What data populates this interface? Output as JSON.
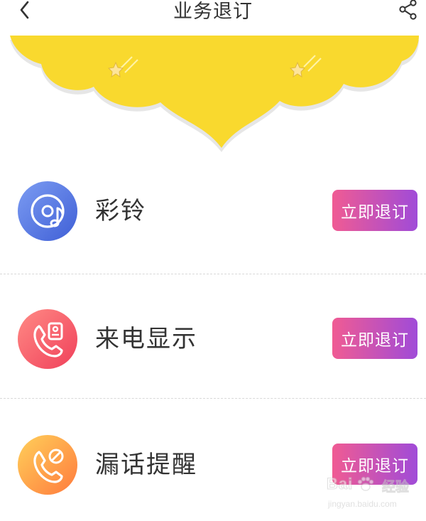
{
  "header": {
    "title": "业务退订",
    "back_icon": "chevron-left-icon",
    "share_icon": "share-icon"
  },
  "banner": {
    "color": "#f9d92e",
    "decorations": [
      "star-icon",
      "star-icon"
    ]
  },
  "services": [
    {
      "name": "彩铃",
      "icon": "music-disc-icon",
      "icon_color": "#4f6fe0",
      "button_label": "立即退订"
    },
    {
      "name": "来电显示",
      "icon": "phone-incoming-icon",
      "icon_color": "#f2526a",
      "button_label": "立即退订"
    },
    {
      "name": "漏话提醒",
      "icon": "phone-missed-icon",
      "icon_color": "#ff9a42",
      "button_label": "立即退订"
    }
  ],
  "button_gradient": [
    "#f05b93",
    "#a04bd8"
  ],
  "watermark": {
    "logo_text": "Bai  ",
    "logo_cn": "经验",
    "url": "jingyan.baidu.com"
  }
}
